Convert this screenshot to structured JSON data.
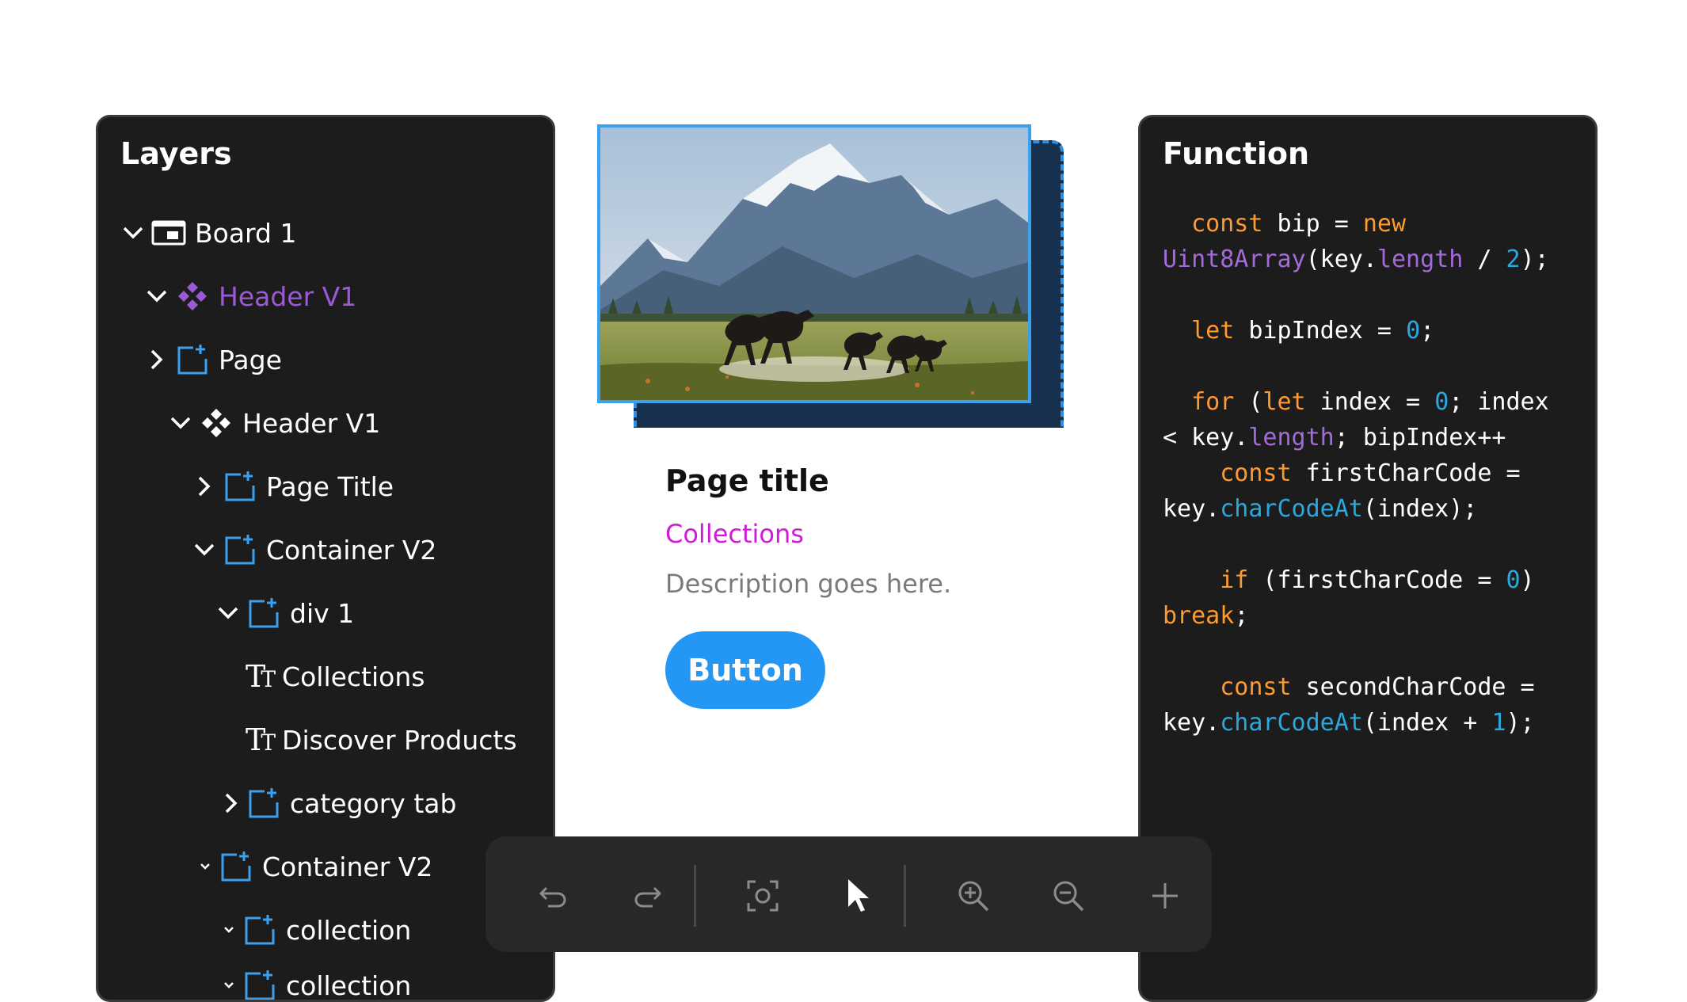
{
  "layers": {
    "title": "Layers",
    "items": [
      {
        "label": "Board 1",
        "icon": "board-icon",
        "expanded": true
      },
      {
        "label": "Header V1",
        "icon": "component-icon",
        "expanded": true,
        "color": "#9b59d6"
      },
      {
        "label": "Page",
        "icon": "frame-icon",
        "expanded": false
      },
      {
        "label": "Header V1",
        "icon": "component-instance-icon",
        "expanded": true
      },
      {
        "label": "Page Title",
        "icon": "frame-icon",
        "expanded": false
      },
      {
        "label": "Container V2",
        "icon": "frame-icon",
        "expanded": true
      },
      {
        "label": "div 1",
        "icon": "frame-icon",
        "expanded": true
      },
      {
        "label": "Collections",
        "icon": "text-icon"
      },
      {
        "label": "Discover Products",
        "icon": "text-icon"
      },
      {
        "label": "category tab",
        "icon": "frame-icon",
        "expanded": false
      },
      {
        "label": "Container V2",
        "icon": "frame-icon",
        "expanded": true
      },
      {
        "label": "collection",
        "icon": "frame-icon",
        "expanded": true
      },
      {
        "label": "collection",
        "icon": "frame-icon",
        "expanded": true
      }
    ]
  },
  "card": {
    "image_alt": "mountains-with-running-horses",
    "title": "Page title",
    "subtitle": "Collections",
    "description": "Description goes here.",
    "button_label": "Button"
  },
  "function": {
    "title": "Function",
    "code": {
      "l1_kw": "const",
      "l1_a": " bip = ",
      "l1_kw2": "new",
      "l2_fn": "Uint8Array",
      "l2_a": "(key.",
      "l2_prop": "length",
      "l2_b": " / ",
      "l2_num": "2",
      "l2_c": ");",
      "l3_kw": "let",
      "l3_a": " bipIndex = ",
      "l3_num": "0",
      "l3_b": ";",
      "l4_kw": "for",
      "l4_a": " (",
      "l4_kw2": "let",
      "l4_b": " index = ",
      "l4_num": "0",
      "l4_c": "; index",
      "l5_a": "< key.",
      "l5_prop": "length",
      "l5_b": "; bipIndex++",
      "l6_kw": "const",
      "l6_a": " firstCharCode =",
      "l7_a": "key.",
      "l7_mth": "charCodeAt",
      "l7_b": "(index);",
      "l8_kw": "if",
      "l8_a": " (firstCharCode = ",
      "l8_num": "0",
      "l8_b": ")",
      "l9_kw": "break",
      "l9_a": ";",
      "l10_kw": "const",
      "l10_a": " secondCharCode =",
      "l11_a": "key.",
      "l11_mth": "charCodeAt",
      "l11_b": "(index + ",
      "l11_num": "1",
      "l11_c": ");"
    }
  },
  "toolbar": {
    "items": [
      "undo-icon",
      "redo-icon",
      "screenshot-icon",
      "pointer-icon",
      "zoom-in-icon",
      "zoom-out-icon",
      "plus-icon"
    ],
    "active": "pointer-icon"
  },
  "colors": {
    "panel_bg": "#1c1c1c",
    "accent_blue": "#2497f4",
    "purple": "#9b59d6",
    "magenta": "#d21bd8",
    "keyword": "#ff9a2e",
    "number": "#2aa8e0"
  }
}
